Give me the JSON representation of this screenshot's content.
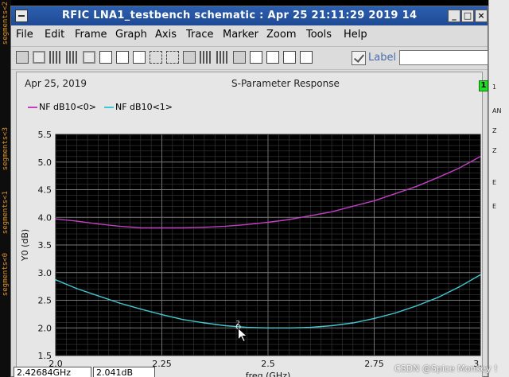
{
  "window": {
    "title": "RFIC LNA1_testbench schematic : Apr 25 21:11:29 2019 14",
    "controls": {
      "minimize": "_",
      "maximize": "□",
      "close": "×"
    }
  },
  "menubar": [
    "File",
    "Edit",
    "Frame",
    "Graph",
    "Axis",
    "Trace",
    "Marker",
    "Zoom",
    "Tools",
    "Help"
  ],
  "toolbar": {
    "icons": [
      "print-icon",
      "print-preview-icon",
      "grid-icon",
      "strip-icon",
      "layout-icon",
      "frame-icon",
      "copy-icon",
      "paste-icon",
      "split-icon",
      "label-yaxis-icon",
      "shade-icon",
      "pattern-icon",
      "hatch-icon",
      "delete-icon",
      "zoom-fit-icon",
      "pan-icon",
      "zoom-in-icon",
      "zoom-box-icon"
    ],
    "label_text": "Label",
    "label_value": ""
  },
  "plot": {
    "date": "Apr 25, 2019",
    "title": "S-Parameter Response",
    "subwindow_badge": "1",
    "colors": {
      "bg": "#000000",
      "grid_major": "#7a7a7a",
      "grid_minor": "#3a3a3a"
    }
  },
  "status": {
    "x_value": "2.42684GHz",
    "y_value": "2.041dB"
  },
  "cursor": {
    "label": "2"
  },
  "left_strip": [
    "segments<2",
    "segments<3",
    "segments<1",
    "segments<0"
  ],
  "right_strip": [
    "1",
    "AN",
    "Z",
    "Z",
    "E",
    "E"
  ],
  "watermark": "CSDN @Spice Monkey !",
  "chart_data": {
    "type": "line",
    "xlabel": "freq (GHz)",
    "ylabel": "Y0 (dB)",
    "xlim": [
      2.0,
      3.0
    ],
    "ylim": [
      1.5,
      5.5
    ],
    "x_ticks": [
      "2.0",
      "2.25",
      "2.5",
      "2.75",
      "3.0"
    ],
    "y_ticks": [
      "1.5",
      "2.0",
      "2.5",
      "3.0",
      "3.5",
      "4.0",
      "4.5",
      "5.0",
      "5.5"
    ],
    "grid": true,
    "legend_position": "top-left",
    "series": [
      {
        "name": "NF dB10<0>",
        "color": "#c040c0",
        "x": [
          2.0,
          2.05,
          2.1,
          2.15,
          2.2,
          2.25,
          2.3,
          2.35,
          2.4,
          2.45,
          2.5,
          2.55,
          2.6,
          2.65,
          2.7,
          2.75,
          2.8,
          2.85,
          2.9,
          2.95,
          3.0
        ],
        "y": [
          3.97,
          3.93,
          3.88,
          3.84,
          3.81,
          3.81,
          3.81,
          3.82,
          3.84,
          3.87,
          3.91,
          3.96,
          4.03,
          4.1,
          4.2,
          4.3,
          4.43,
          4.56,
          4.72,
          4.89,
          5.1
        ]
      },
      {
        "name": "NF dB10<1>",
        "color": "#40c8d0",
        "x": [
          2.0,
          2.05,
          2.1,
          2.15,
          2.2,
          2.25,
          2.3,
          2.35,
          2.4,
          2.45,
          2.5,
          2.55,
          2.6,
          2.65,
          2.7,
          2.75,
          2.8,
          2.85,
          2.9,
          2.95,
          3.0
        ],
        "y": [
          2.87,
          2.71,
          2.58,
          2.45,
          2.34,
          2.24,
          2.15,
          2.09,
          2.04,
          2.01,
          2.0,
          2.0,
          2.01,
          2.04,
          2.09,
          2.17,
          2.27,
          2.4,
          2.55,
          2.74,
          2.96
        ]
      }
    ]
  }
}
